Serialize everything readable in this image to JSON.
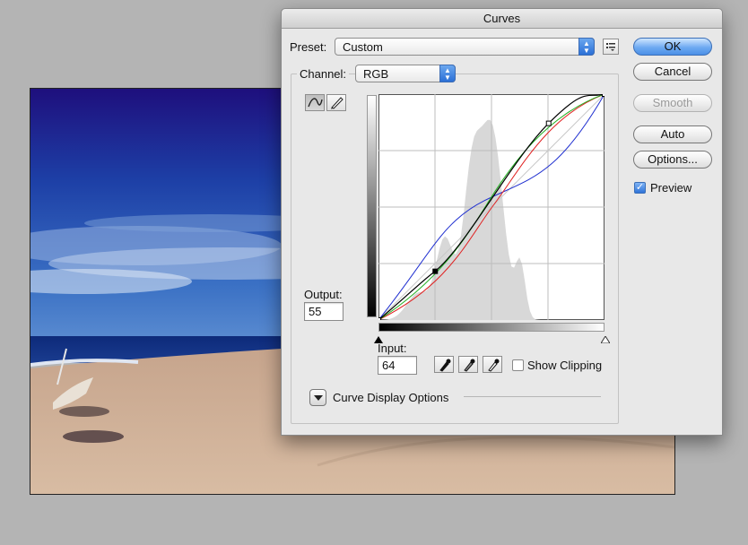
{
  "dialog": {
    "title": "Curves"
  },
  "preset": {
    "label": "Preset:",
    "value": "Custom",
    "options_icon": "preset-options-icon"
  },
  "channel": {
    "label": "Channel:",
    "value": "RGB"
  },
  "buttons": {
    "ok": "OK",
    "cancel": "Cancel",
    "smooth": "Smooth",
    "auto": "Auto",
    "options": "Options..."
  },
  "preview": {
    "label": "Preview",
    "checked": true
  },
  "output": {
    "label": "Output:",
    "value": "55"
  },
  "input": {
    "label": "Input:",
    "value": "64"
  },
  "show_clipping": {
    "label": "Show Clipping",
    "checked": false
  },
  "curve_display_options": {
    "label": "Curve Display Options"
  },
  "tools": [
    {
      "name": "curve-point-tool-icon",
      "active": true
    },
    {
      "name": "pencil-tool-icon",
      "active": false
    }
  ],
  "eyedroppers": [
    "black-point-eyedropper-icon",
    "gray-point-eyedropper-icon",
    "white-point-eyedropper-icon"
  ],
  "curves": {
    "control_points": [
      [
        0,
        0
      ],
      [
        64,
        55
      ],
      [
        192,
        222
      ],
      [
        255,
        255
      ]
    ],
    "colors": {
      "rgb": "#000000",
      "red": "#e02020",
      "green": "#20b020",
      "blue": "#2030d0"
    }
  }
}
